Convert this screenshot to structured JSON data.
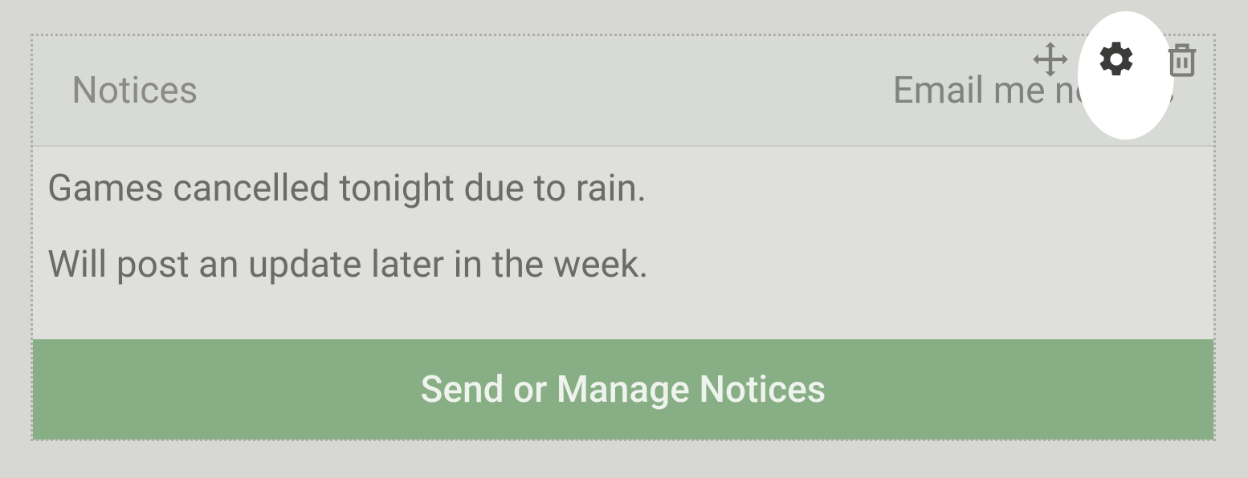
{
  "widget": {
    "title": "Notices",
    "email_link": "Email me notices",
    "notices": [
      "Games cancelled tonight due to rain.",
      "Will post an update later in the week."
    ],
    "action_button": "Send or Manage Notices"
  },
  "toolbar": {
    "move_icon": "move-icon",
    "settings_icon": "gear-icon",
    "delete_icon": "trash-icon"
  }
}
